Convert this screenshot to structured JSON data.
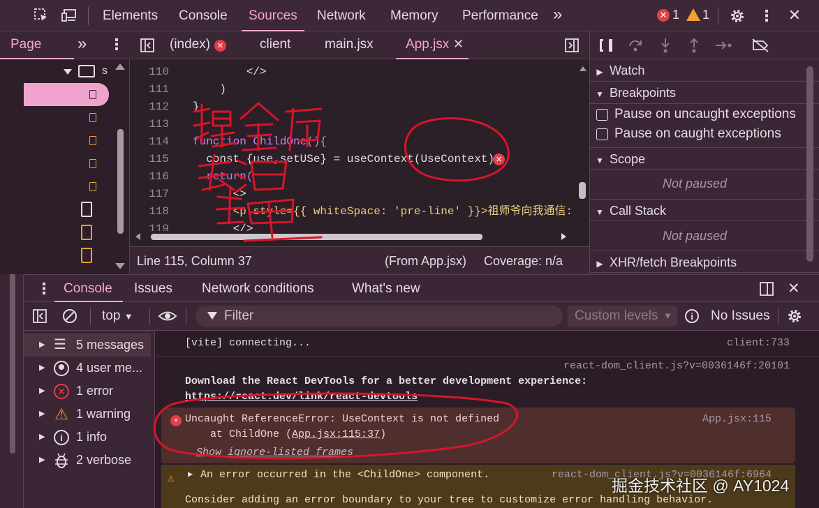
{
  "toolbar": {
    "tabs": [
      "Elements",
      "Console",
      "Sources",
      "Network",
      "Memory",
      "Performance"
    ],
    "more": "»",
    "error_count": "1",
    "warning_count": "1"
  },
  "navigator": {
    "page_tab": "Page",
    "more": "»",
    "folder_label": "s"
  },
  "editor": {
    "file_tabs": [
      {
        "label": "(index)",
        "has_error": true
      },
      {
        "label": "client"
      },
      {
        "label": "main.jsx"
      },
      {
        "label": "App.jsx",
        "active": true
      }
    ],
    "lines": [
      {
        "n": "110",
        "code": "        </>"
      },
      {
        "n": "111",
        "code": "    )"
      },
      {
        "n": "112",
        "code": "}"
      },
      {
        "n": "113",
        "code": ""
      },
      {
        "n": "114",
        "code": "function ChildOne(){"
      },
      {
        "n": "115",
        "code": "  const {use,setUSe} = useContext(UseContext)"
      },
      {
        "n": "116",
        "code": "  return("
      },
      {
        "n": "117",
        "code": "      <>"
      },
      {
        "n": "118",
        "code": "      <p style={{ whiteSpace: 'pre-line' }}>祖师爷向我通信:"
      },
      {
        "n": "119",
        "code": "      </>"
      }
    ],
    "status_position": "Line 115, Column 37",
    "status_from": "(From App.jsx)",
    "status_coverage": "Coverage: n/a"
  },
  "debugger": {
    "watch": "Watch",
    "breakpoints": "Breakpoints",
    "pause_uncaught": "Pause on uncaught exceptions",
    "pause_caught": "Pause on caught exceptions",
    "scope": "Scope",
    "scope_status": "Not paused",
    "call_stack": "Call Stack",
    "call_stack_status": "Not paused",
    "xhr": "XHR/fetch Breakpoints"
  },
  "drawer": {
    "tabs": [
      "Console",
      "Issues",
      "Network conditions",
      "What's new"
    ]
  },
  "console_toolbar": {
    "context": "top",
    "filter_placeholder": "Filter",
    "levels": "Custom levels",
    "issues": "No Issues"
  },
  "console_sidebar": [
    {
      "label": "5 messages",
      "icon": "list-icon"
    },
    {
      "label": "4 user me...",
      "icon": "user-icon"
    },
    {
      "label": "1 error",
      "icon": "error-icon"
    },
    {
      "label": "1 warning",
      "icon": "warning-icon"
    },
    {
      "label": "1 info",
      "icon": "info-icon"
    },
    {
      "label": "2 verbose",
      "icon": "bug-icon"
    }
  ],
  "console_messages": {
    "m1_text": "[vite] connecting...",
    "m1_src": "client:733",
    "m2_src": "react-dom_client.js?v=0036146f:20101",
    "m2_text": "Download the React DevTools for a better development experience:",
    "m2_link": "https://react.dev/link/react-devtools",
    "err_text": "Uncaught ReferenceError: UseContext is not defined",
    "err_at": "at ChildOne (",
    "err_link": "App.jsx:115:37",
    "err_close": ")",
    "err_src": "App.jsx:115",
    "err_more": "Show ignore-listed frames",
    "warn_text": "An error occurred in the <ChildOne> component.",
    "warn_src": "react-dom_client.js?v=0036146f:6964",
    "warn_next": "Consider adding an error boundary to your tree to customize error handling behavior."
  },
  "annotation": {
    "handwritten": "提全局变量"
  },
  "watermark": "掘金技术社区 @ AY1024",
  "colors": {
    "accent": "#f4a8d0",
    "error": "#e0404a",
    "warning": "#f0a030",
    "ink": "#d8152a"
  }
}
